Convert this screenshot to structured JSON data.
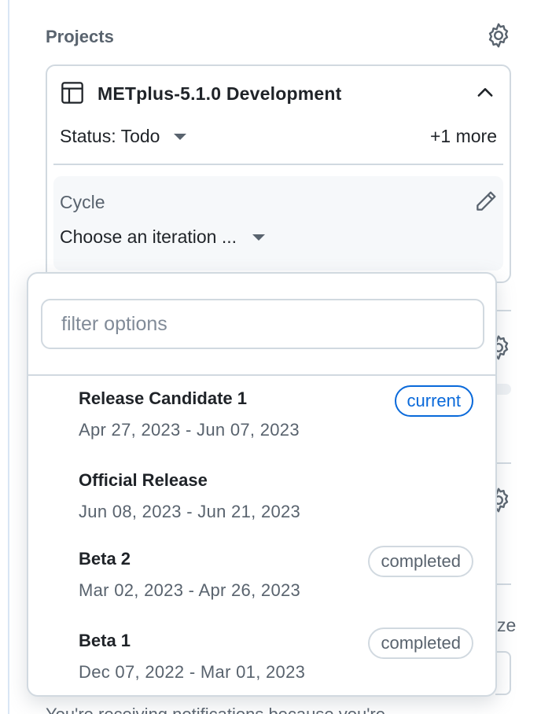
{
  "sidebar": {
    "section_title": "Projects",
    "background_fragment": "ze",
    "notice_text": "You're receiving notifications because you're"
  },
  "project": {
    "name": "METplus-5.1.0 Development",
    "status_label": "Status: Todo",
    "more_label": "+1 more",
    "field": {
      "label": "Cycle",
      "value": "Choose an iteration ..."
    }
  },
  "dropdown": {
    "filter_placeholder": "filter options",
    "filter_value": "",
    "options": [
      {
        "title": "Release Candidate 1",
        "dates": "Apr 27, 2023 - Jun 07, 2023",
        "badge": "current"
      },
      {
        "title": "Official Release",
        "dates": "Jun 08, 2023 - Jun 21, 2023",
        "badge": ""
      },
      {
        "title": "Beta 2",
        "dates": "Mar 02, 2023 - Apr 26, 2023",
        "badge": "completed"
      },
      {
        "title": "Beta 1",
        "dates": "Dec 07, 2022 - Mar 01, 2023",
        "badge": "completed"
      }
    ]
  },
  "colors": {
    "accent": "#0969da",
    "muted_text": "#59636e",
    "border": "#d1d9e0",
    "field_bg": "#f6f8fa"
  },
  "icons": {
    "settings": "gear-icon",
    "project_type": "table-icon",
    "collapse": "chevron-up-icon",
    "edit": "pencil-icon",
    "dropdown": "caret-down-icon"
  }
}
